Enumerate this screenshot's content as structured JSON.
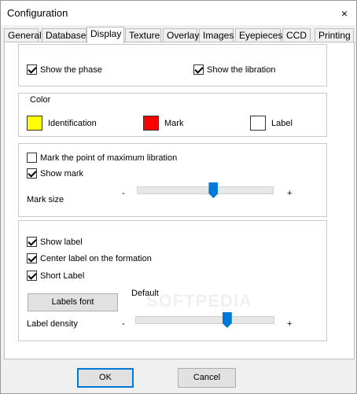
{
  "window": {
    "title": "Configuration",
    "close_glyph": "×"
  },
  "tabs": [
    {
      "label": "General"
    },
    {
      "label": "Database"
    },
    {
      "label": "Display"
    },
    {
      "label": "Texture"
    },
    {
      "label": "Overlay"
    },
    {
      "label": "Images"
    },
    {
      "label": "Eyepieces"
    },
    {
      "label": "CCD"
    },
    {
      "label": "Printing"
    }
  ],
  "active_tab": "Display",
  "phase_group": {
    "show_phase": {
      "label": "Show the phase",
      "checked": true
    },
    "show_libration": {
      "label": "Show the libration",
      "checked": true
    }
  },
  "color_group": {
    "title": "Color",
    "identification": {
      "label": "Identification",
      "color": "#ffff00"
    },
    "mark": {
      "label": "Mark",
      "color": "#ff0000"
    },
    "label": {
      "label": "Label",
      "color": "#ffffff"
    }
  },
  "mark_group": {
    "max_libration": {
      "label": "Mark the point of maximum libration",
      "checked": false
    },
    "show_mark": {
      "label": "Show mark",
      "checked": true
    },
    "mark_size_label": "Mark size",
    "min_symbol": "-",
    "max_symbol": "+",
    "mark_size_value": 0.56
  },
  "label_group": {
    "show_label": {
      "label": "Show label",
      "checked": true
    },
    "center_label": {
      "label": "Center label on the formation",
      "checked": true
    },
    "short_label": {
      "label": "Short Label",
      "checked": true
    },
    "labels_font_button": "Labels font",
    "default_text": "Default",
    "label_density_label": "Label density",
    "min_symbol": "-",
    "max_symbol": "+",
    "label_density_value": 0.66
  },
  "watermark": "SOFTPEDIA",
  "buttons": {
    "ok": "OK",
    "cancel": "Cancel"
  },
  "accent_color": "#0078d7"
}
